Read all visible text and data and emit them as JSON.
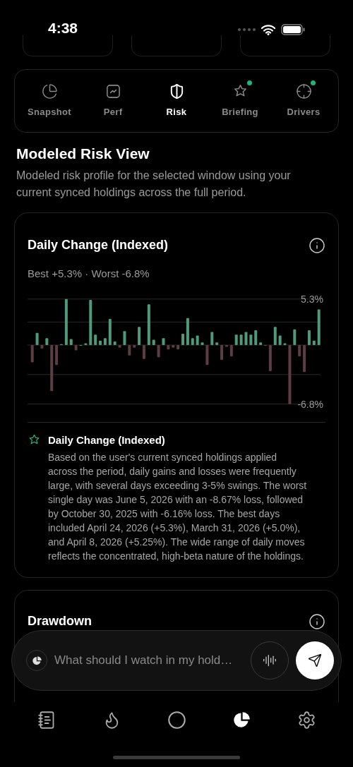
{
  "status_bar": {
    "time": "4:38"
  },
  "tabs": [
    {
      "label": "Snapshot",
      "kind": "pie",
      "selected": false,
      "badge": false
    },
    {
      "label": "Perf",
      "kind": "trend",
      "selected": false,
      "badge": false
    },
    {
      "label": "Risk",
      "kind": "shield",
      "selected": true,
      "badge": false
    },
    {
      "label": "Briefing",
      "kind": "star",
      "selected": false,
      "badge": true
    },
    {
      "label": "Drivers",
      "kind": "crosshair",
      "selected": false,
      "badge": true
    }
  ],
  "section": {
    "title": "Modeled Risk View",
    "description": "Modeled risk profile for the selected window using your current synced holdings across the full period."
  },
  "daily_card": {
    "title": "Daily Change (Indexed)",
    "summary": "Best +5.3% · Worst -6.8%",
    "chart_data": {
      "type": "bar",
      "ylim": [
        -6.8,
        5.3
      ],
      "yticks": [
        {
          "value": 5.3,
          "label": "5.3%"
        },
        {
          "value": -6.8,
          "label": "-6.8%"
        }
      ],
      "series": [
        {
          "color": "#4f9a7a",
          "values": [
            null,
            1.4,
            null,
            0.8,
            null,
            null,
            0.1,
            5.3,
            0.7,
            null,
            0.0,
            0.2,
            5.2,
            1.2,
            0.5,
            0.8,
            3.0,
            0.4,
            null,
            1.6,
            null,
            null,
            2.1,
            null,
            4.7,
            0.6,
            null,
            0.8,
            null,
            null,
            null,
            1.3,
            3.1,
            0.8,
            1.1,
            0.3,
            null,
            1.5,
            0.3,
            null,
            null,
            null,
            1.2,
            1.2,
            1.5,
            1.2,
            1.7,
            0.3,
            null,
            null,
            2.1,
            1.1,
            0.2,
            null,
            1.8,
            null,
            null,
            1.7,
            0.5,
            4.1
          ]
        },
        {
          "color": "#5c3d43",
          "values": [
            -2.0,
            null,
            -0.4,
            null,
            -5.3,
            -2.3,
            null,
            null,
            null,
            -0.6,
            null,
            null,
            null,
            null,
            null,
            null,
            null,
            null,
            -0.3,
            null,
            -1.2,
            -0.3,
            null,
            -1.6,
            null,
            null,
            -1.4,
            null,
            -0.5,
            -0.3,
            -0.5,
            null,
            null,
            null,
            null,
            null,
            -2.3,
            null,
            null,
            -1.7,
            -0.2,
            -1.3,
            null,
            null,
            null,
            null,
            null,
            null,
            -0.1,
            -3.0,
            null,
            null,
            null,
            -6.8,
            null,
            -1.3,
            -3.1,
            null,
            null,
            null
          ]
        }
      ]
    },
    "insight": {
      "title": "Daily Change (Indexed)",
      "text": "Based on the user's current synced holdings applied across the period, daily gains and losses were frequently large, with several days exceeding 3-5% swings. The worst single day was June 5, 2026 with an -8.67% loss, followed by October 30, 2025 with -6.16% loss. The best days included April 24, 2026 (+5.3%), March 31, 2026 (+5.0%), and April 8, 2026 (+5.25%). The wide range of daily moves reflects the concentrated, high-beta nature of the holdings."
    }
  },
  "drawdown_card": {
    "title": "Drawdown"
  },
  "composer": {
    "placeholder": "What should I watch in my hold…"
  },
  "bottom_nav": [
    {
      "kind": "notes",
      "selected": false
    },
    {
      "kind": "flame",
      "selected": false
    },
    {
      "kind": "circle",
      "selected": false
    },
    {
      "kind": "pie",
      "selected": true
    },
    {
      "kind": "settings",
      "selected": false
    }
  ]
}
